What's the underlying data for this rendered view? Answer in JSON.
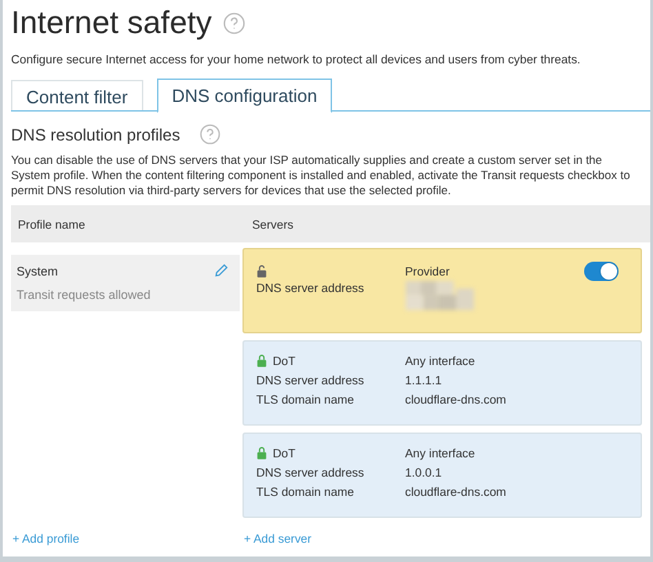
{
  "page": {
    "title": "Internet safety",
    "description": "Configure secure Internet access for your home network to protect all devices and users from cyber threats."
  },
  "tabs": [
    {
      "label": "Content filter",
      "selected": false
    },
    {
      "label": "DNS configuration",
      "selected": true
    }
  ],
  "section": {
    "title": "DNS resolution profiles",
    "text": "You can disable the use of DNS servers that your ISP automatically supplies and create a custom server set in the System profile. When the content filtering component is installed and enabled, activate the Transit requests checkbox to permit DNS resolution via third-party servers for devices that use the selected profile."
  },
  "table": {
    "columns": [
      "Profile name",
      "Servers"
    ],
    "profiles": [
      {
        "name": "System",
        "note": "Transit requests allowed",
        "selected": true
      }
    ],
    "servers": [
      {
        "kind": "provider",
        "type": "Provider",
        "enabled": true,
        "rows": [
          {
            "label": "DNS server address",
            "value": null
          }
        ]
      },
      {
        "kind": "dot",
        "type": "DoT",
        "interface": "Any interface",
        "rows": [
          {
            "label": "DNS server address",
            "value": "1.1.1.1"
          },
          {
            "label": "TLS domain name",
            "value": "cloudflare-dns.com"
          }
        ]
      },
      {
        "kind": "dot",
        "type": "DoT",
        "interface": "Any interface",
        "rows": [
          {
            "label": "DNS server address",
            "value": "1.0.0.1"
          },
          {
            "label": "TLS domain name",
            "value": "cloudflare-dns.com"
          }
        ]
      }
    ],
    "add_profile": "+ Add profile",
    "add_server": "+ Add server"
  }
}
